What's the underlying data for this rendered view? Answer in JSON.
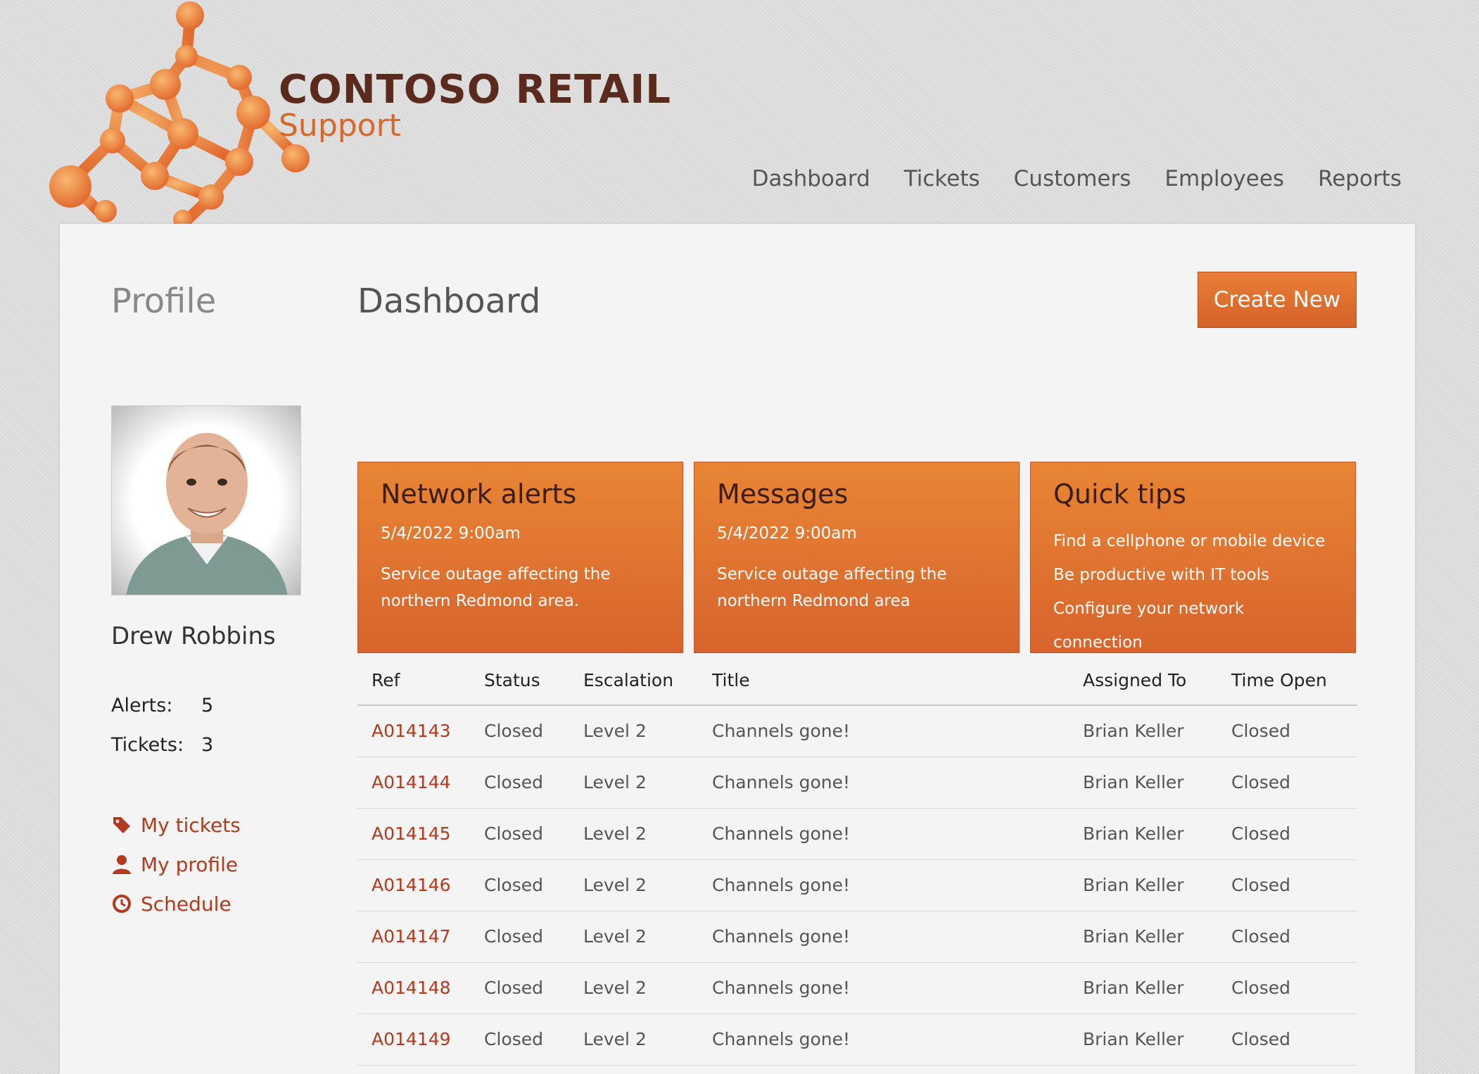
{
  "brand": {
    "name": "CONTOSO RETAIL",
    "subtitle": "Support"
  },
  "nav": [
    "Dashboard",
    "Tickets",
    "Customers",
    "Employees",
    "Reports"
  ],
  "profile_heading": "Profile",
  "page_title": "Dashboard",
  "create_button": "Create New",
  "user": {
    "name": "Drew Robbins",
    "alerts_label": "Alerts:",
    "alerts": "5",
    "tickets_label": "Tickets:",
    "tickets": "3"
  },
  "sidebar_links": [
    {
      "label": "My tickets",
      "icon": "tag-icon"
    },
    {
      "label": "My profile",
      "icon": "person-icon"
    },
    {
      "label": "Schedule",
      "icon": "clock-icon"
    }
  ],
  "tiles": {
    "network": {
      "title": "Network alerts",
      "date": "5/4/2022 9:00am",
      "text": "Service outage affecting the northern Redmond area."
    },
    "messages": {
      "title": "Messages",
      "date": "5/4/2022 9:00am",
      "text": "Service outage affecting the northern Redmond area"
    },
    "tips": {
      "title": "Quick tips",
      "items": [
        "Find a cellphone or mobile device",
        "Be productive with IT tools",
        "Configure your network connection"
      ]
    }
  },
  "table": {
    "headers": [
      "Ref",
      "Status",
      "Escalation",
      "Title",
      "Assigned To",
      "Time Open"
    ],
    "rows": [
      [
        "A014143",
        "Closed",
        "Level 2",
        "Channels gone!",
        "Brian Keller",
        "Closed"
      ],
      [
        "A014144",
        "Closed",
        "Level 2",
        "Channels gone!",
        "Brian Keller",
        "Closed"
      ],
      [
        "A014145",
        "Closed",
        "Level 2",
        "Channels gone!",
        "Brian Keller",
        "Closed"
      ],
      [
        "A014146",
        "Closed",
        "Level 2",
        "Channels gone!",
        "Brian Keller",
        "Closed"
      ],
      [
        "A014147",
        "Closed",
        "Level 2",
        "Channels gone!",
        "Brian Keller",
        "Closed"
      ],
      [
        "A014148",
        "Closed",
        "Level 2",
        "Channels gone!",
        "Brian Keller",
        "Closed"
      ],
      [
        "A014149",
        "Closed",
        "Level 2",
        "Channels gone!",
        "Brian Keller",
        "Closed"
      ]
    ]
  },
  "colors": {
    "accent": "#d8642c",
    "link": "#b23a1e",
    "brand_dark": "#5a2a1c"
  }
}
